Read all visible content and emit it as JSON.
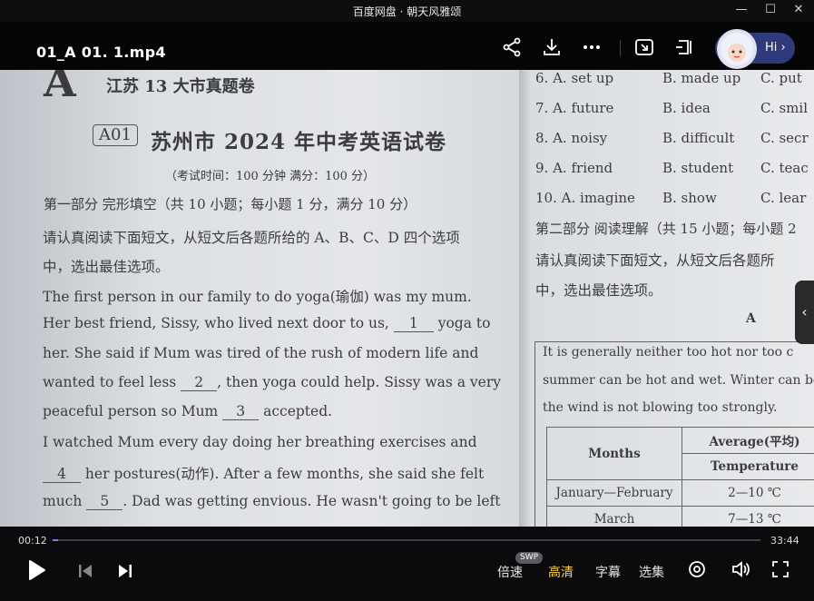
{
  "window": {
    "title": "百度网盘 · 朝天风雅颂"
  },
  "player": {
    "filename": "01_A 01.  1.mp4",
    "hi_label": "Hi ›"
  },
  "doc": {
    "big_letter": "A",
    "section_heading": "江苏 13 大市真题卷",
    "code": "A01",
    "title": "苏州市 2024 年中考英语试卷",
    "time_line": "（考试时间：100 分钟   满分：100 分）",
    "part1_heading": "第一部分   完形填空（共 10 小题；每小题 1 分，满分 10 分）",
    "lines": [
      {
        "t": "     请认真阅读下面短文，从短文后各题所给的 A、B、C、D 四个选项"
      },
      {
        "t": "中，选出最佳选项。"
      },
      {
        "t": "     The first person in our family to do yoga(瑜伽) was my mum."
      },
      {
        "pre": "Her best friend, Sissy, who lived next door to us, ",
        "blank": "1",
        "post": " yoga to"
      },
      {
        "t": "her. She said if Mum was tired of the rush of modern life and"
      },
      {
        "pre": "wanted to feel less ",
        "blank": "2",
        "post": ", then yoga could help. Sissy was a very"
      },
      {
        "pre": "peaceful person so Mum ",
        "blank": "3",
        "post": " accepted."
      },
      {
        "t": "     I watched Mum every day doing her breathing exercises and"
      },
      {
        "pre": "",
        "blank": "4",
        "post": " her postures(动作). After a few months, she said she felt"
      },
      {
        "pre": "much ",
        "blank": "5",
        "post": ". Dad was getting envious. He wasn't going to be left"
      }
    ],
    "options": [
      {
        "n": "6. A.",
        "a": "set up",
        "b": "B. made up",
        "c": "C. put"
      },
      {
        "n": "7. A.",
        "a": "future",
        "b": "B. idea",
        "c": "C. smil"
      },
      {
        "n": "8. A.",
        "a": "noisy",
        "b": "B. difficult",
        "c": "C. secr"
      },
      {
        "n": "9. A.",
        "a": "friend",
        "b": "B. student",
        "c": "C. teac"
      },
      {
        "n": "10. A.",
        "a": "imagine",
        "b": "B. show",
        "c": "C. lear"
      }
    ],
    "part2_heading": "第二部分   阅读理解（共 15 小题；每小题 2",
    "part2_line1": "     请认真阅读下面短文，从短文后各题所",
    "part2_line2": "中，选出最佳选项。",
    "section_a": "A",
    "passage": [
      "     It is generally neither too hot nor too c",
      "summer can be hot and wet. Winter can be a lit",
      "the wind is not blowing too strongly."
    ],
    "table": {
      "col1": "Months",
      "col2a": "Average(平均)",
      "col2b": "Temperature",
      "rows": [
        {
          "m": "January—February",
          "t": "2—10 ℃"
        },
        {
          "m": "March",
          "t": "7—13 ℃"
        }
      ]
    }
  },
  "controls": {
    "current_time": "00:12",
    "total_time": "33:44",
    "progress_fraction": 0.008,
    "speed_label": "倍速",
    "swp_badge": "SWP",
    "quality_label": "高清",
    "subtitle_label": "字幕",
    "episodes_label": "选集"
  },
  "colors": {
    "accent": "#ffd24a",
    "progress": "#7b7bff"
  }
}
